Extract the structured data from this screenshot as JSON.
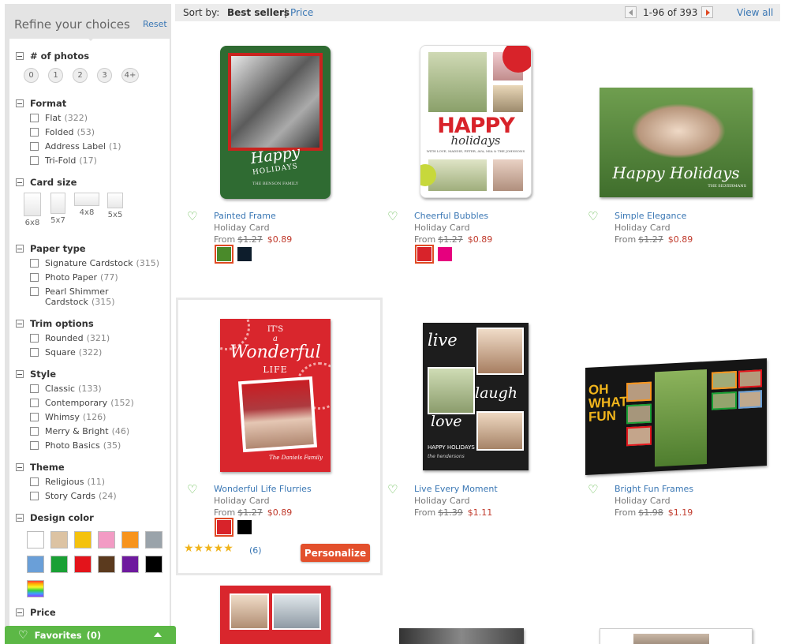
{
  "sidebar": {
    "title": "Refine your choices",
    "reset": "Reset",
    "photos": {
      "heading": "# of photos",
      "options": [
        "0",
        "1",
        "2",
        "3",
        "4+"
      ]
    },
    "format": {
      "heading": "Format",
      "options": [
        {
          "label": "Flat",
          "count": "(322)"
        },
        {
          "label": "Folded",
          "count": "(53)"
        },
        {
          "label": "Address Label",
          "count": "(1)"
        },
        {
          "label": "Tri-Fold",
          "count": "(17)"
        }
      ]
    },
    "size": {
      "heading": "Card size",
      "options": [
        "6x8",
        "5x7",
        "4x8",
        "5x5"
      ]
    },
    "paper": {
      "heading": "Paper type",
      "options": [
        {
          "label": "Signature Cardstock",
          "count": "(315)"
        },
        {
          "label": "Photo Paper",
          "count": "(77)"
        },
        {
          "label": "Pearl Shimmer",
          "label2": "Cardstock",
          "count": "(315)"
        }
      ]
    },
    "trim": {
      "heading": "Trim options",
      "options": [
        {
          "label": "Rounded",
          "count": "(321)"
        },
        {
          "label": "Square",
          "count": "(322)"
        }
      ]
    },
    "style": {
      "heading": "Style",
      "options": [
        {
          "label": "Classic",
          "count": "(133)"
        },
        {
          "label": "Contemporary",
          "count": "(152)"
        },
        {
          "label": "Whimsy",
          "count": "(126)"
        },
        {
          "label": "Merry & Bright",
          "count": "(46)"
        },
        {
          "label": "Photo Basics",
          "count": "(35)"
        }
      ]
    },
    "theme": {
      "heading": "Theme",
      "options": [
        {
          "label": "Religious",
          "count": "(11)"
        },
        {
          "label": "Story Cards",
          "count": "(24)"
        }
      ]
    },
    "color": {
      "heading": "Design color",
      "swatches": [
        "#ffffff",
        "#dcc3a3",
        "#f4c20d",
        "#f29bc4",
        "#f7941d",
        "#9aa3aa",
        "#6a9fd8",
        "#1aa035",
        "#e3141b",
        "#5b3a1e",
        "#6e1a9e",
        "#000000"
      ]
    },
    "price": {
      "heading": "Price"
    }
  },
  "favorites": {
    "label": "Favorites",
    "count": "(0)"
  },
  "toolbar": {
    "sort_by": "Sort by:",
    "best_sellers": "Best sellers",
    "separator": "|",
    "price": "Price",
    "range": "1-96 of 393",
    "view_all": "View all"
  },
  "products": [
    {
      "name": "Painted Frame",
      "type": "Holiday Card",
      "from": "From",
      "old": "$1.27",
      "new": "$0.89",
      "colors": [
        "#4a8a2a",
        "#0d1d2c"
      ],
      "art_script": "Happy",
      "art_line": "HOLIDAYS",
      "art_small": "THE BENSON FAMILY"
    },
    {
      "name": "Cheerful Bubbles",
      "type": "Holiday Card",
      "from": "From",
      "old": "$1.27",
      "new": "$0.89",
      "colors": [
        "#d8232a",
        "#e6007e"
      ],
      "art_big": "HAPPY",
      "art_script": "holidays",
      "art_small": "WITH LOVE, MADDIE, PETER, AVA, MIA & THE JOHNSONS"
    },
    {
      "name": "Simple Elegance",
      "type": "Holiday Card",
      "from": "From",
      "old": "$1.27",
      "new": "$0.89",
      "colors": [],
      "art_script": "Happy Holidays",
      "art_small": "THE SILVERMANS"
    },
    {
      "name": "Wonderful Life Flurries",
      "type": "Holiday Card",
      "from": "From",
      "old": "$1.27",
      "new": "$0.89",
      "colors": [
        "#d8232a",
        "#000000"
      ],
      "art_small_top": "IT'S",
      "art_a": "a",
      "art_script": "Wonderful",
      "art_line": "LIFE",
      "art_small": "The Daniels Family"
    },
    {
      "name": "Live Every Moment",
      "type": "Holiday Card",
      "from": "From",
      "old": "$1.39",
      "new": "$1.11",
      "colors": [],
      "art_w1": "live",
      "art_w2": "laugh",
      "art_w3": "love",
      "art_line": "HAPPY HOLIDAYS",
      "art_small": "the hendersons"
    },
    {
      "name": "Bright Fun Frames",
      "type": "Holiday Card",
      "from": "From",
      "old": "$1.98",
      "new": "$1.19",
      "colors": [],
      "art_big": "OH WHAT FUN"
    }
  ],
  "rating": {
    "stars": "★★★★★",
    "reviews": "(6)"
  },
  "personalize": "Personalize"
}
